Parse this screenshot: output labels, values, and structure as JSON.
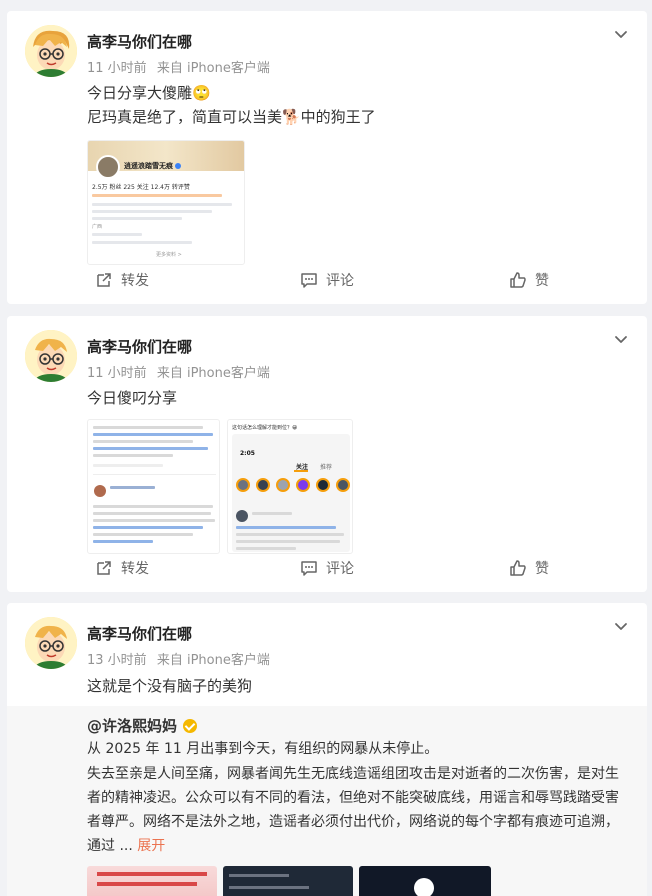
{
  "colors": {
    "background": "#f1f2f5",
    "card": "#ffffff",
    "link_orange": "#eb7350",
    "meta_gray": "#939393",
    "verified_gold": "#f5b800"
  },
  "posts": [
    {
      "author": "高李马你们在哪",
      "time": "11 小时前",
      "source": "来自 iPhone客户端",
      "lines": [
        "今日分享大傻雕🙄",
        "尼玛真是绝了，简直可以当美🐕中的狗王了"
      ],
      "image_profile": {
        "name": "逍遥浪踏雪无痕",
        "stats": "2.5万 粉丝   225 关注   12.4万 转评赞",
        "location": "广西",
        "more": "更多资料 >"
      },
      "actions": {
        "repost": "转发",
        "comment": "评论",
        "like": "赞"
      }
    },
    {
      "author": "高李马你们在哪",
      "time": "11 小时前",
      "source": "来自 iPhone客户端",
      "lines": [
        "今日傻叼分享"
      ],
      "image_right": {
        "question": "这句话怎么理解才能到位？😀",
        "time": "2:05",
        "tab_follow": "关注",
        "tab_recommend": "推荐"
      },
      "actions": {
        "repost": "转发",
        "comment": "评论",
        "like": "赞"
      }
    },
    {
      "author": "高李马你们在哪",
      "time": "13 小时前",
      "source": "来自 iPhone客户端",
      "lines": [
        "这就是个没有脑子的美狗"
      ],
      "quoted": {
        "user": "@许洛熙妈妈",
        "para1": "从 2025 年 11 月出事到今天，有组织的网暴从未停止。",
        "para2_line1": "失去至亲是人间至痛，网暴者闻先生无底线造谣组团攻击是对逝者的二次伤害，是对生",
        "para2_line2": "者的精神凌迟。公众可以有不同的看法，但绝对不能突破底线，用谣言和辱骂践踏受害",
        "para2_line3": "者尊严。网络不是法外之地，造谣者必须付出代价，网络说的每个字都有痕迹可追溯，",
        "para2_line4": "通过  ...",
        "expand": "展开"
      }
    }
  ]
}
